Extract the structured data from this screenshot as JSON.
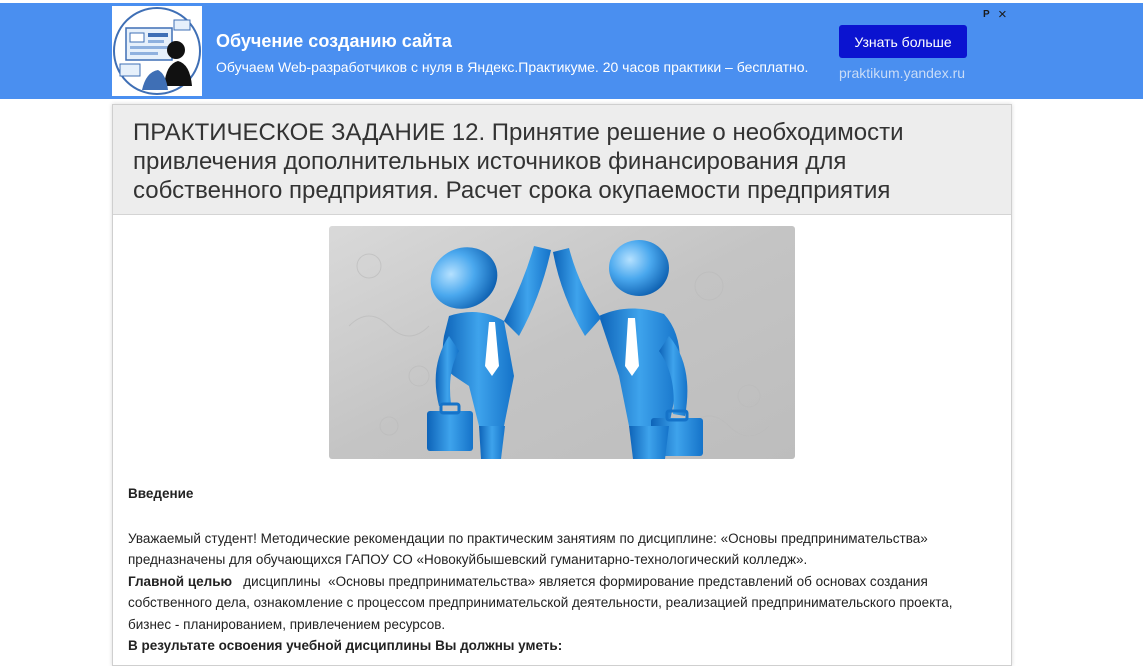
{
  "ad": {
    "title": "Обучение созданию сайта",
    "description": "Обучаем Web-разработчиков с нуля в Яндекс.Практикуме. 20 часов практики – бесплатно.",
    "cta_label": "Узнать больше",
    "domain": "praktikum.yandex.ru",
    "marker": "Р",
    "close_icon": "×",
    "colors": {
      "background": "#4a8ff0",
      "button": "#0b13d0"
    }
  },
  "article": {
    "title": "ПРАКТИЧЕСКОЕ ЗАДАНИЕ 12. Принятие решение о необходимости привлечения дополнительных источников финансирования для собственного предприятия. Расчет срока окупаемости предприятия",
    "intro_heading": "Введение",
    "paragraph1": "Уважаемый студент! Методические рекомендации по практическим занятиям по дисциплине: «Основы предпринимательства» предназначены для обучающихся ГАПОУ СО «Новокуйбышевский гуманитарно-технологический колледж».",
    "goal_label": "Главной  целью",
    "goal_text": "   дисциплины  «Основы предпринимательства» является формирование представлений об основах создания собственного дела, ознакомление с процессом предпринимательской деятельности, реализацией предпринимательского проекта, бизнес - планированием, привлечением ресурсов.",
    "outcome_heading": "В результате освоения учебной дисциплины Вы должны уметь:"
  }
}
